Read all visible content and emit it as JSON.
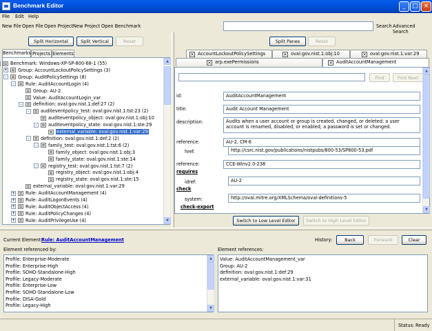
{
  "window": {
    "title": "Benchmark Editor",
    "minimize": "_",
    "maximize": "□",
    "close": "×"
  },
  "menu": [
    "File",
    "Edit",
    "Help"
  ],
  "toolbar": {
    "items": [
      "New File",
      "Open File",
      "Open Project",
      "New Project",
      "Open Benchmark"
    ],
    "search_value": "",
    "search_label": "Search",
    "advanced_search": "Advanced Search"
  },
  "left": {
    "split_horizontal": "Split Horizontal",
    "split_vertical": "Split Vertical",
    "reset": "Reset",
    "tabs": [
      "Benchmarks",
      "Projects",
      "Elements"
    ],
    "tree": [
      "Benchmark: Windows-XP-SP-800-68-1 (55)",
      "Group: AccountLockoutPolicySettings (3)",
      "Group: AuditPolicySettings (8)",
      "Rule: AuditAccountLogin (4)",
      "Group: AU-2",
      "Value: AuditAccountLogin_var",
      "definition: oval:gov.nist.1:def:27 (2)",
      "auditeventpolicy_test: oval:gov.nist.1:tst:23 (2)",
      "auditeventpolicy_object: oval:gov.nist.1:obj:10",
      "auditeventpolicy_state: oval:gov.nist.1:ste:29",
      "external_variable: oval:gov.nist.1:var:29",
      "definition: oval:gov.nist.1:def:2 (2)",
      "family_test: oval:gov.nist.1:tst:6 (2)",
      "family_object: oval:gov.nist.1:obj:3",
      "family_state: oval:gov.nist.1:ste:14",
      "registry_test: oval:gov.nist.1:tst:7 (2)",
      "registry_object: oval:gov.nist.1:obj:4",
      "registry_state: oval:gov.nist.1:ste:15",
      "external_variable: oval:gov.nist.1:var:29",
      "Rule: AuditAccountManagement (4)",
      "Rule: AuditLogonEvents (4)",
      "Rule: AuditObjectAccess (4)",
      "Rule: AuditPolicyChanges (4)",
      "Rule: AuditPrivilegeUse (4)"
    ]
  },
  "right": {
    "split_panes": "Split Panes",
    "reset": "Reset",
    "tabs_row1": [
      "AccountLockoutPolicySettings",
      "oval:gov.nist.1:obj:10",
      "oval:gov.nist.1:var:29"
    ],
    "tabs_row2": [
      "arp.exePermissions",
      "AuditAccountManagement"
    ],
    "find": "Find",
    "find_next": "Find Next",
    "find_value": "",
    "fields": {
      "id_label": "id:",
      "id": "AuditAccountManagement",
      "title_label": "title:",
      "title": "Audit Account Management",
      "description_label": "description:",
      "description": "Audits when a user account or group is created, changed, or deleted; a user account is renamed, disabled, or enabled; a password is set or changed.",
      "reference_label": "reference:",
      "reference1": "AU-2, CM-6",
      "href_label": "href:",
      "href": "http://csrc.nist.gov/publications/nistpubs/800-53/SP800-53.pdf",
      "reference2": "CCE-Winv2.0-238",
      "requires": "requires",
      "idref_label": "idref:",
      "idref": "AU-2",
      "check": "check",
      "system_label": "system:",
      "system": "http://oval.mitre.org/XMLSchema/oval-definitions-5",
      "check_export": "check-export"
    },
    "switch_low": "Switch to Low Level Editor",
    "switch_high": "Switch to High Level Editor"
  },
  "bottom": {
    "current_label": "Current Element:",
    "current_value": "Rule: AuditAccountManagement",
    "history_label": "History:",
    "back": "Back",
    "forward": "Forward",
    "clear": "Clear",
    "referenced_by_label": "Element referenced by:",
    "referenced_by": [
      "Profile: Enterprise-Moderate",
      "Profile: Enterprise-High",
      "Profile: SOHO-Standalone-High",
      "Profile: Legacy-Moderate",
      "Profile: Enterprise-Low",
      "Profile: SOHO-Standalone-Low",
      "Profile: DISA-Gold",
      "Profile: Legacy-High"
    ],
    "references_label": "Element references:",
    "references": [
      "Value: AuditAccountManagement_var",
      "Group: AU-2",
      "definition: oval:gov.nist.1:def:29",
      "external_variable: oval:gov.nist.1:var:31"
    ]
  },
  "status": {
    "label": "Status:",
    "value": "Ready"
  }
}
